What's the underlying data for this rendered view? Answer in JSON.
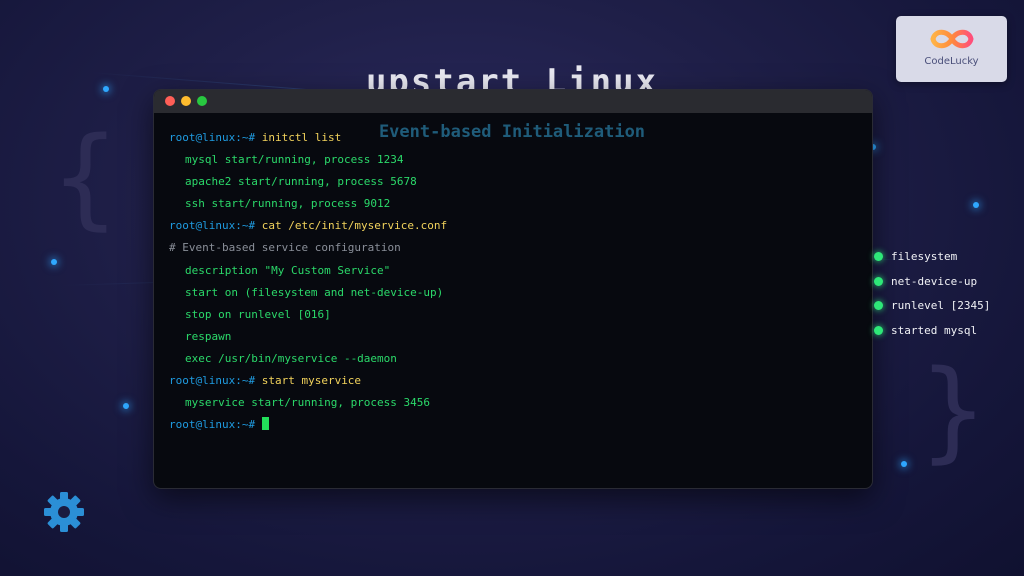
{
  "background": {
    "title": "upstart Linux",
    "subtitle": "Event-based Initialization",
    "brace_left": "{",
    "brace_right": "}"
  },
  "terminal": {
    "lines": [
      {
        "type": "command",
        "prompt": "root@linux:~#",
        "text": "initctl list"
      },
      {
        "type": "output",
        "text": "mysql start/running, process 1234"
      },
      {
        "type": "output",
        "text": "apache2 start/running, process 5678"
      },
      {
        "type": "output",
        "text": "ssh start/running, process 9012"
      },
      {
        "type": "command",
        "prompt": "root@linux:~#",
        "text": "cat /etc/init/myservice.conf"
      },
      {
        "type": "comment",
        "text": "# Event-based service configuration"
      },
      {
        "type": "output",
        "text": "description \"My Custom Service\""
      },
      {
        "type": "output",
        "text": "start on (filesystem and net-device-up)"
      },
      {
        "type": "output",
        "text": "stop on runlevel [016]"
      },
      {
        "type": "output",
        "text": "respawn"
      },
      {
        "type": "output",
        "text": "exec /usr/bin/myservice --daemon"
      },
      {
        "type": "command",
        "prompt": "root@linux:~#",
        "text": "start myservice"
      },
      {
        "type": "output",
        "text": "myservice start/running, process 3456"
      },
      {
        "type": "prompt",
        "prompt": "root@linux:~#",
        "text": ""
      }
    ]
  },
  "events": [
    "filesystem",
    "net-device-up",
    "runlevel [2345]",
    "started mysql"
  ],
  "logo": {
    "name": "CodeLucky"
  },
  "icons": {
    "settings": "gear-icon",
    "logo": "infinity-logo-icon"
  },
  "colors": {
    "prompt": "#1f9be0",
    "command": "#f2d35c",
    "output": "#2bd96a",
    "comment": "#8a8f99",
    "cursor": "#22e05a",
    "event_dot": "#2ee878",
    "accent_dot": "#2fa8ff",
    "gear": "#2b8fd6"
  }
}
